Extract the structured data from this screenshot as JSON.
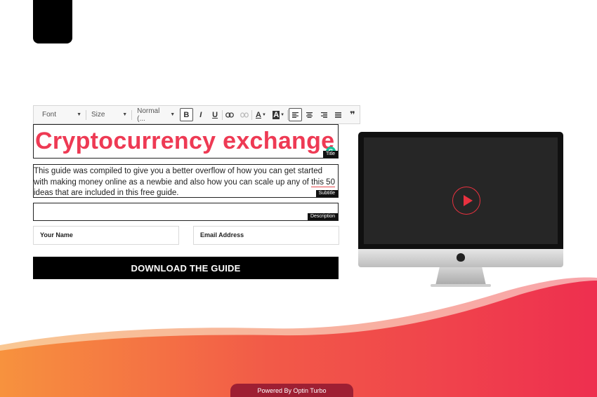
{
  "toolbar": {
    "font_label": "Font",
    "size_label": "Size",
    "format_label": "Normal (...",
    "bold": "B",
    "italic": "I",
    "underline": "U",
    "font_color": "A",
    "bg_color": "A",
    "quote": "❞"
  },
  "editor": {
    "title": "Cryptocurrency exchange",
    "title_tag": "Title",
    "subtitle_before": "This guide was compiled to give you a better overflow of how you can get started with making money online as a newbie and also how you can scale up any of ",
    "subtitle_highlight": "this 50",
    "subtitle_after": " ideas that are included in this free guide.",
    "subtitle_tag": "Subtitle",
    "description_tag": "Description"
  },
  "form": {
    "name_placeholder": "Your Name",
    "email_placeholder": "Email Address",
    "button_label": "DOWNLOAD THE GUIDE"
  },
  "footer": {
    "powered_by": "Powered By Optin Turbo"
  },
  "colors": {
    "title": "#ee3a54",
    "wave_start": "#f7923e",
    "wave_end": "#ee2f4f"
  }
}
